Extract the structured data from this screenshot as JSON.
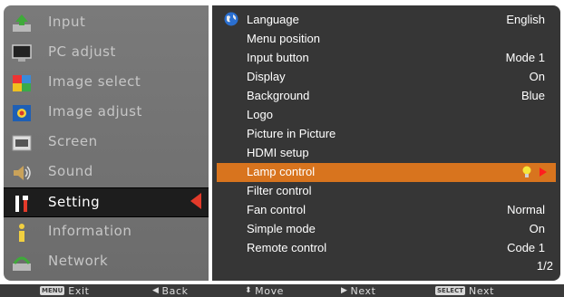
{
  "left_menu": {
    "items": [
      {
        "label": "Input",
        "icon": "input-icon"
      },
      {
        "label": "PC adjust",
        "icon": "monitor-icon"
      },
      {
        "label": "Image select",
        "icon": "image-select-icon"
      },
      {
        "label": "Image adjust",
        "icon": "image-adjust-icon"
      },
      {
        "label": "Screen",
        "icon": "screen-icon"
      },
      {
        "label": "Sound",
        "icon": "speaker-icon"
      },
      {
        "label": "Setting",
        "icon": "wrench-screwdriver-icon"
      },
      {
        "label": "Information",
        "icon": "information-icon"
      },
      {
        "label": "Network",
        "icon": "network-icon"
      }
    ],
    "selected": "Setting"
  },
  "right_panel": {
    "rows": [
      {
        "label": "Language",
        "value": "English"
      },
      {
        "label": "Menu position",
        "value": ""
      },
      {
        "label": "Input button",
        "value": "Mode 1"
      },
      {
        "label": "Display",
        "value": "On"
      },
      {
        "label": "Background",
        "value": "Blue"
      },
      {
        "label": "Logo",
        "value": ""
      },
      {
        "label": "Picture in Picture",
        "value": ""
      },
      {
        "label": "HDMI setup",
        "value": ""
      },
      {
        "label": "Lamp control",
        "value": ""
      },
      {
        "label": "Filter control",
        "value": ""
      },
      {
        "label": "Fan control",
        "value": "Normal"
      },
      {
        "label": "Simple mode",
        "value": "On"
      },
      {
        "label": "Remote control",
        "value": "Code 1"
      }
    ],
    "highlighted": "Lamp control",
    "page_indicator": "1/2"
  },
  "bottom_bar": {
    "exit_key": "MENU",
    "exit_label": "Exit",
    "back_label": "Back",
    "move_label": "Move",
    "next_label": "Next",
    "select_key": "SELECT",
    "select_next_label": "Next"
  },
  "colors": {
    "highlight": "#d8741e",
    "selection_arrow": "#e23a2a",
    "panel_bg": "#363636",
    "menu_bg": "#727272"
  }
}
